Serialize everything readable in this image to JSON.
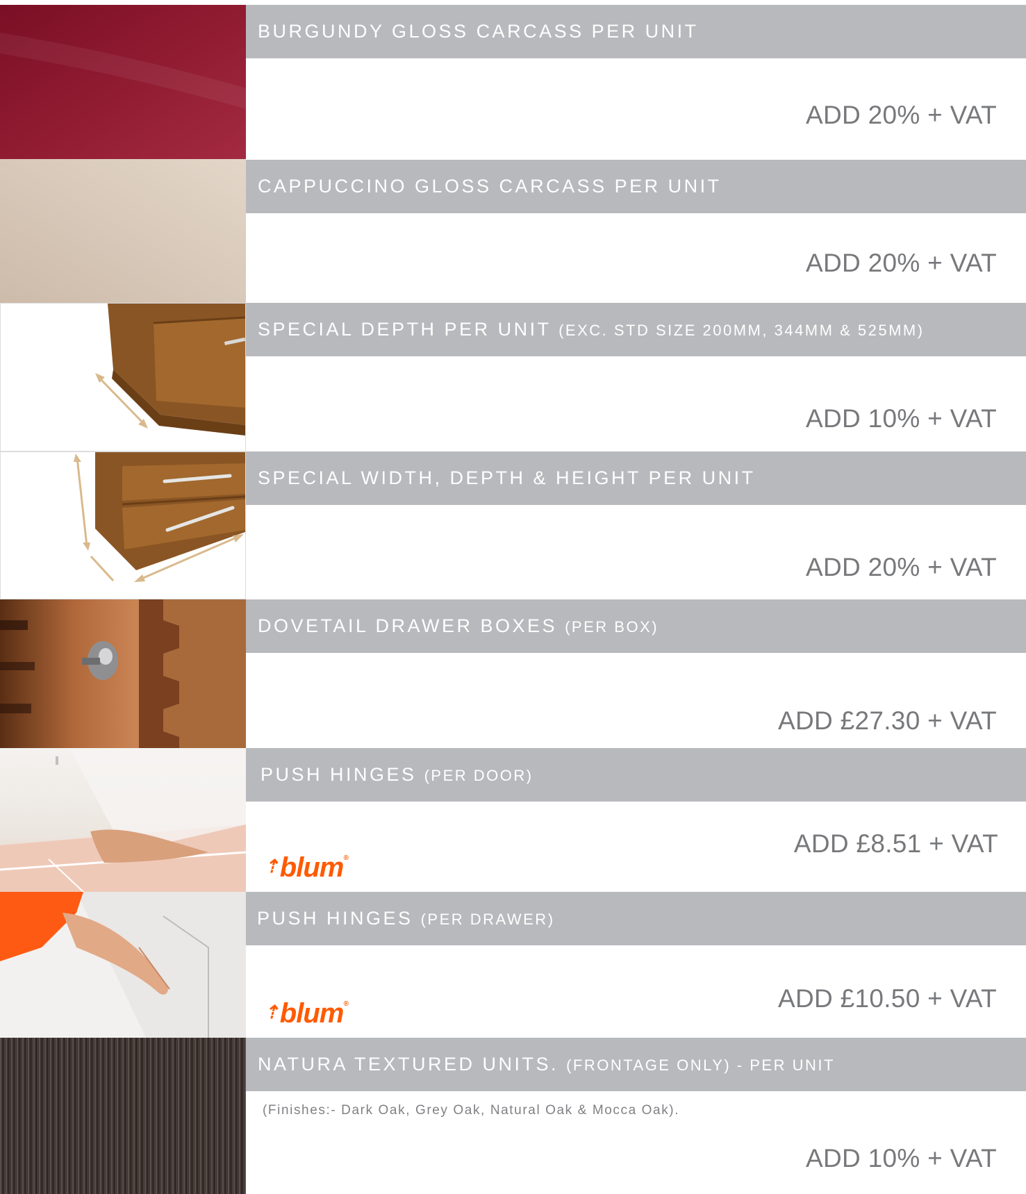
{
  "rows": [
    {
      "title": "BURGUNDY GLOSS CARCASS PER UNIT",
      "sub": "",
      "price": "ADD 20% + VAT"
    },
    {
      "title": "CAPPUCCINO GLOSS CARCASS PER UNIT",
      "sub": "",
      "price": "ADD 20% + VAT"
    },
    {
      "title": "SPECIAL DEPTH PER UNIT",
      "sub": "(EXC. STD SIZE 200MM, 344MM & 525MM)",
      "price": "ADD 10% + VAT"
    },
    {
      "title": "SPECIAL WIDTH, DEPTH & HEIGHT PER UNIT",
      "sub": "",
      "price": "ADD 20% + VAT"
    },
    {
      "title": "DOVETAIL DRAWER BOXES",
      "sub": "(PER BOX)",
      "price": "ADD £27.30 + VAT"
    },
    {
      "title": "PUSH HINGES",
      "sub": "(PER DOOR)",
      "price": "ADD £8.51 + VAT",
      "logo": "blum"
    },
    {
      "title": "PUSH HINGES",
      "sub": "(PER DRAWER)",
      "price": "ADD £10.50 + VAT",
      "logo": "blum"
    },
    {
      "title": "NATURA TEXTURED UNITS.",
      "sub": "(FRONTAGE ONLY) - PER UNIT",
      "price": "ADD 10% + VAT",
      "note": "(Finishes:- Dark Oak, Grey Oak, Natural Oak & Mocca Oak)."
    }
  ],
  "colors": {
    "bar": "#b8b9bc",
    "price_text": "#77787b",
    "blum_orange": "#ff5a00"
  },
  "icons": [
    "burgundy-swatch",
    "cappuccino-swatch",
    "drawer-depth-diagram",
    "drawer-dimensions-diagram",
    "dovetail-drawer-photo",
    "push-door-photo",
    "push-drawer-photo",
    "natura-wood-swatch"
  ]
}
